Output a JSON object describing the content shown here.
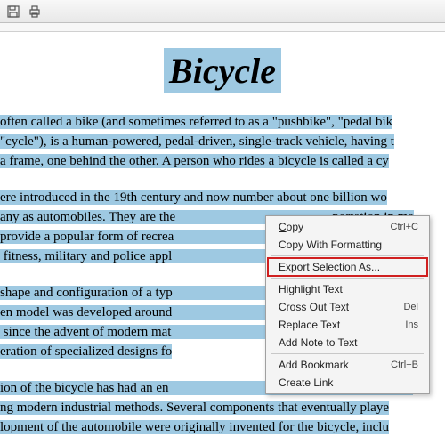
{
  "toolbar": {
    "save_name": "save-icon",
    "print_name": "print-icon"
  },
  "document": {
    "title": "Bicycle",
    "para1_hl": "often called a bike (and sometimes referred to as a \"pushbike\", \"pedal bik",
    "para1_line2_hl": "\"cycle\"), is a human-powered, pedal-driven, single-track vehicle, having t",
    "para1_line3_hl": "a frame, one behind the other. A person who rides a bicycle is called a cy",
    "para2_l1": "ere introduced in the 19th century and now number about one billion wo",
    "para2_l2": "any as automobiles. They are the                                               portation in ma",
    "para2_l3": "provide a popular form of recrea                                              ted for such use",
    "para2_l4": " fitness, military and police appl                                                and bicycle raci",
    "para3_l1": "shape and configuration of a typ                                              hanged little sin",
    "para3_l2": "en model was developed around                                              etails have been",
    "para3_l3": " since the advent of modern mat                                               design. These h",
    "para3_l4": "eration of specialized designs fo",
    "para4_l1": "ion of the bicycle has had an en                                               , both in terms o",
    "para4_l2": "ng modern industrial methods. Several components that eventually playe",
    "para4_l3": "lopment of the automobile were originally invented for the bicycle, inclu"
  },
  "context_menu": {
    "copy": "Copy",
    "copy_shortcut": "Ctrl+C",
    "copy_fmt": "Copy With Formatting",
    "export": "Export Selection As...",
    "highlight": "Highlight Text",
    "crossout": "Cross Out Text",
    "crossout_shortcut": "Del",
    "replace": "Replace Text",
    "replace_shortcut": "Ins",
    "addnote": "Add Note to Text",
    "bookmark": "Add Bookmark",
    "bookmark_shortcut": "Ctrl+B",
    "createlink": "Create Link"
  }
}
